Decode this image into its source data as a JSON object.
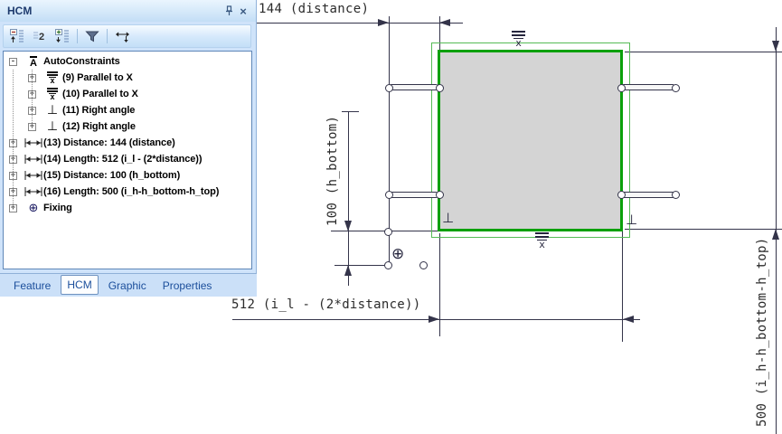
{
  "panel": {
    "title": "HCM",
    "close_glyph": "×",
    "toolbar": {
      "buttons": [
        {
          "name": "collapse-all"
        },
        {
          "name": "expand-to-level-2"
        },
        {
          "name": "expand-all"
        },
        {
          "name": "filter"
        },
        {
          "name": "pan-arrows"
        }
      ]
    },
    "tree": {
      "items": [
        {
          "toggle": "-",
          "icon": "autoconstraints",
          "label": "AutoConstraints",
          "depth": 0
        },
        {
          "toggle": "+",
          "icon": "parallel-to-x",
          "label": "(9) Parallel to X",
          "depth": 1
        },
        {
          "toggle": "+",
          "icon": "parallel-to-x",
          "label": "(10) Parallel to X",
          "depth": 1
        },
        {
          "toggle": "+",
          "icon": "right-angle",
          "label": "(11) Right angle",
          "depth": 1
        },
        {
          "toggle": "+",
          "icon": "right-angle",
          "label": "(12) Right angle",
          "depth": 1
        },
        {
          "toggle": "+",
          "icon": "dimension",
          "label": "(13) Distance: 144 (distance)",
          "depth": 0
        },
        {
          "toggle": "+",
          "icon": "dimension",
          "label": "(14) Length: 512 (i_l - (2*distance))",
          "depth": 0
        },
        {
          "toggle": "+",
          "icon": "dimension",
          "label": "(15) Distance: 100 (h_bottom)",
          "depth": 0
        },
        {
          "toggle": "+",
          "icon": "dimension",
          "label": "(16) Length: 500 (i_h-h_bottom-h_top)",
          "depth": 0
        },
        {
          "toggle": "+",
          "icon": "fixing",
          "label": "Fixing",
          "depth": 0
        }
      ]
    },
    "tabs": {
      "items": [
        "Feature",
        "HCM",
        "Graphic",
        "Properties"
      ],
      "active": "HCM"
    }
  },
  "drawing": {
    "dimensions": {
      "top": "144 (distance)",
      "bottom": "512 (i_l - (2*distance))",
      "left": "100 (h_bottom)",
      "right": "500 (i_h-h_bottom-h_top)"
    },
    "constraint_markers": {
      "parallel_glyph": "x",
      "perpendicular_glyph": "⊥",
      "anchor_glyph": "⊕"
    }
  },
  "colors": {
    "panel_blue": "#cfe3fa",
    "shape_stroke_thick": "#0aa00a",
    "shape_stroke_thin": "#55bb55",
    "shape_fill": "#d4d4d4",
    "sketch_line": "#34344a",
    "tab_text": "#1b4e9b"
  }
}
